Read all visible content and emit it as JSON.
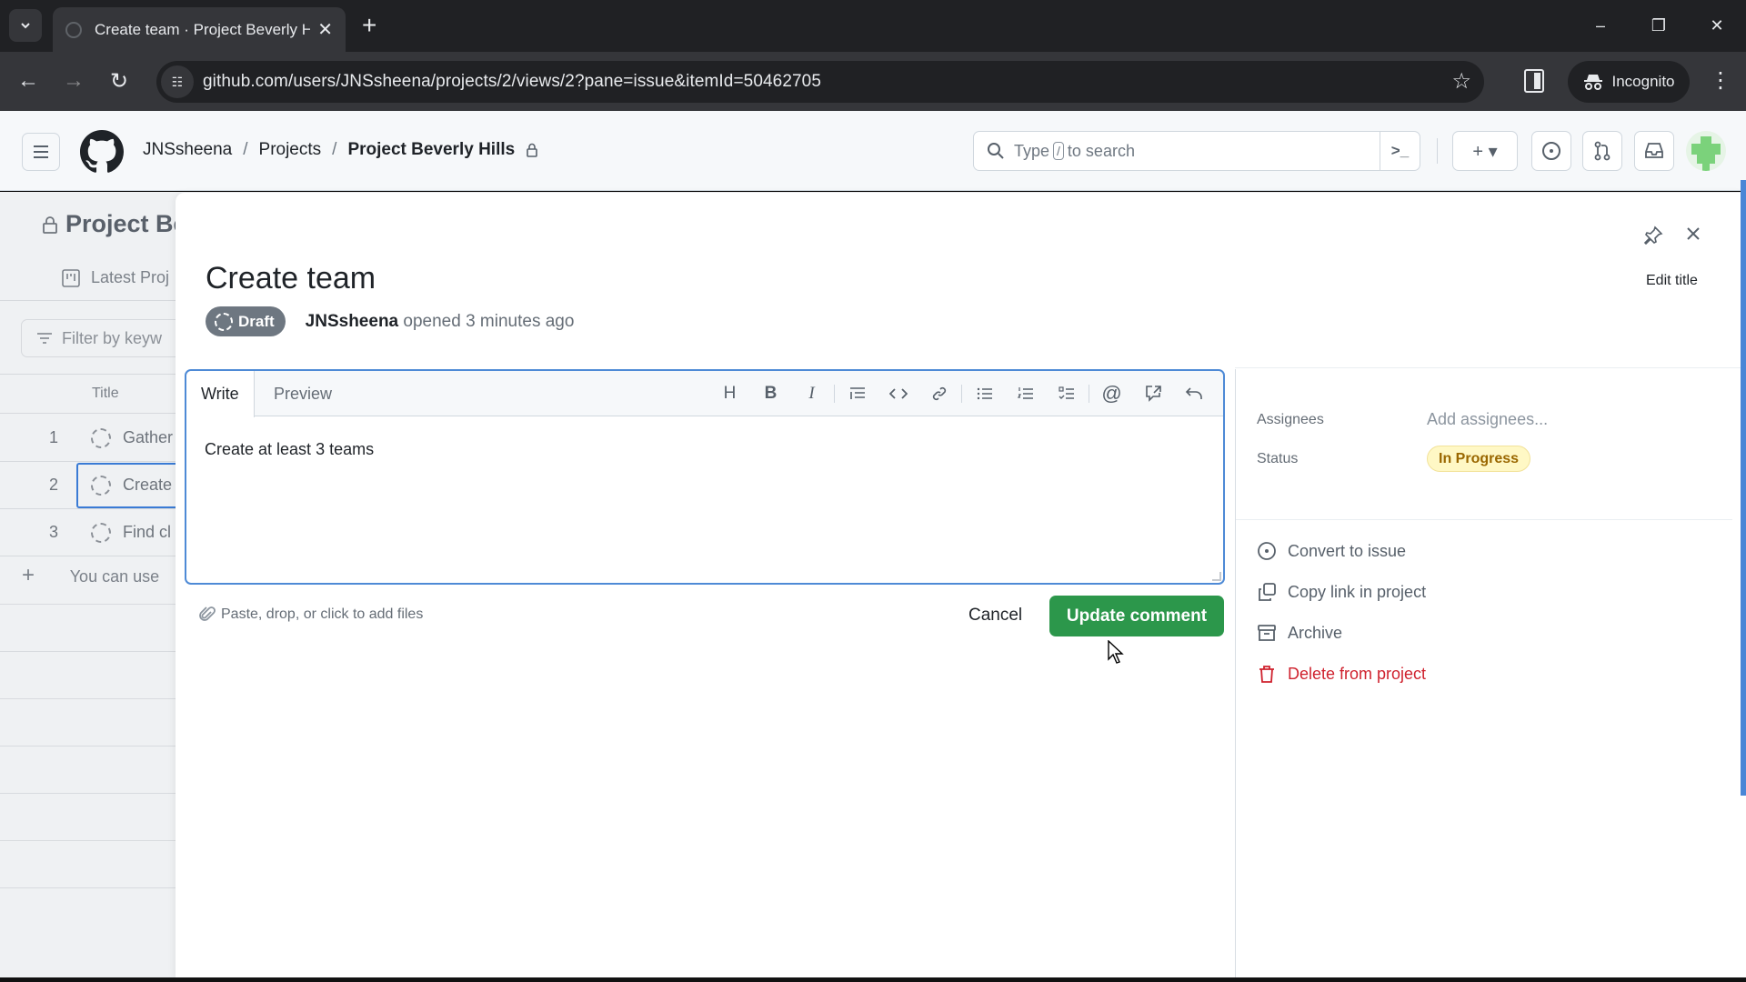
{
  "browser": {
    "tab_title": "Create team · Project Beverly Hills",
    "url": "github.com/users/JNSsheena/projects/2/views/2?pane=issue&itemId=50462705",
    "incognito_label": "Incognito",
    "icons": {
      "tab_list": "chevron-down-icon",
      "tab_close": "✕",
      "new_tab": "+",
      "back": "←",
      "forward": "→",
      "reload": "↻",
      "site_info": "☷",
      "star": "☆",
      "menu": "⋮",
      "minimize": "–",
      "restore": "❐",
      "close": "✕"
    }
  },
  "header": {
    "breadcrumb": [
      "JNSsheena",
      "Projects",
      "Project Beverly Hills"
    ],
    "breadcrumb_sep": "/",
    "search_prefix": "Type",
    "search_key": "/",
    "search_suffix": "to search",
    "command_palette": ">_",
    "create_label": "+ ▾",
    "icons": [
      "plus-icon",
      "issue-opened-icon",
      "pull-request-icon",
      "inbox-icon"
    ]
  },
  "background_project": {
    "title": "Project Be",
    "view_tab": "Latest Proj",
    "filter_placeholder": "Filter by keyw",
    "column_title": "Title",
    "rows": [
      {
        "num": "1",
        "title": "Gather"
      },
      {
        "num": "2",
        "title": "Create"
      },
      {
        "num": "3",
        "title": "Find cl"
      }
    ],
    "add_hint": "You can use"
  },
  "panel": {
    "edit_title_label": "Edit title",
    "issue_title": "Create team",
    "state_badge": "Draft",
    "author": "JNSsheena",
    "opened_text": "opened 3 minutes ago",
    "editor": {
      "tabs": [
        "Write",
        "Preview"
      ],
      "active_tab": "Write",
      "content": "Create at least 3 teams",
      "toolbar": [
        {
          "name": "heading",
          "glyph": "H"
        },
        {
          "name": "bold",
          "glyph": "B"
        },
        {
          "name": "italic",
          "glyph": "I"
        },
        {
          "name": "quote",
          "glyph": "≡"
        },
        {
          "name": "code",
          "glyph": "<>"
        },
        {
          "name": "link",
          "glyph": "🔗"
        },
        {
          "name": "unordered-list",
          "glyph": "☰"
        },
        {
          "name": "ordered-list",
          "glyph": "☰"
        },
        {
          "name": "task-list",
          "glyph": "☑"
        },
        {
          "name": "mention",
          "glyph": "@"
        },
        {
          "name": "cross-reference",
          "glyph": "↗"
        },
        {
          "name": "undo",
          "glyph": "↶"
        }
      ]
    },
    "attach_hint": "Paste, drop, or click to add files",
    "cancel_label": "Cancel",
    "submit_label": "Update comment",
    "fields": {
      "assignees_label": "Assignees",
      "assignees_placeholder": "Add assignees...",
      "status_label": "Status",
      "status_value": "In Progress"
    },
    "actions": [
      {
        "label": "Convert to issue",
        "icon": "issue-opened-icon"
      },
      {
        "label": "Copy link in project",
        "icon": "copy-icon"
      },
      {
        "label": "Archive",
        "icon": "archive-icon"
      },
      {
        "label": "Delete from project",
        "icon": "trash-icon"
      }
    ]
  },
  "colors": {
    "primary_button": "#2c974b",
    "danger": "#cf222e",
    "status_bg": "#fff8c5",
    "status_fg": "#9a6700",
    "focus_border": "#4e8ad6"
  }
}
